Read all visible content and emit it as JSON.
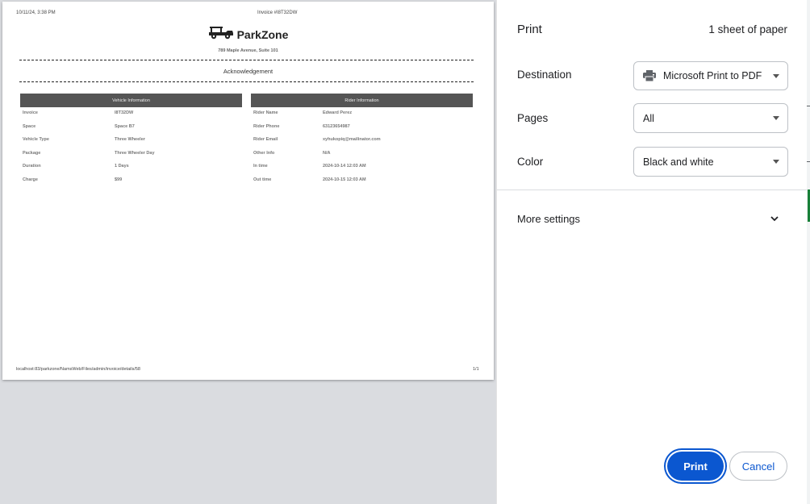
{
  "preview": {
    "header_date": "10/11/24, 3:38 PM",
    "header_title": "Invoice #I8T32DW",
    "brand_name": "ParkZone",
    "address": "789 Maple Avenue, Suite 101",
    "acknowledgement": "Acknowledgement",
    "vehicle_panel": {
      "title": "Vehicle Information",
      "rows": [
        {
          "label": "Invoice",
          "value": "I8T32DW"
        },
        {
          "label": "Space",
          "value": "Space B7"
        },
        {
          "label": "Vehicle Type",
          "value": "Three Wheeler"
        },
        {
          "label": "Package",
          "value": "Three Wheeler Day"
        },
        {
          "label": "Duration",
          "value": "1 Days"
        },
        {
          "label": "Charge",
          "value": "$99"
        }
      ]
    },
    "rider_panel": {
      "title": "Rider Information",
      "rows": [
        {
          "label": "Rider Name",
          "value": "Edward Perez"
        },
        {
          "label": "Rider Phone",
          "value": "63123654987"
        },
        {
          "label": "Rider Email",
          "value": "xyhukopiq@mailinator.com"
        },
        {
          "label": "Other Info",
          "value": "N/A"
        },
        {
          "label": "In time",
          "value": "2024-10-14 12:03 AM"
        },
        {
          "label": "Out time",
          "value": "2024-10-15 12:03 AM"
        }
      ]
    },
    "footer_url": "localhost:83/parkzone/NamsWeb/Files/admin/invoice/details/58",
    "footer_page": "1/1"
  },
  "settings": {
    "title": "Print",
    "sheet_count": "1 sheet of paper",
    "destination_label": "Destination",
    "destination_value": "Microsoft Print to PDF",
    "destination_icon": "printer-icon",
    "pages_label": "Pages",
    "pages_value": "All",
    "color_label": "Color",
    "color_value": "Black and white",
    "more_settings": "More settings",
    "print_button": "Print",
    "cancel_button": "Cancel"
  },
  "colors": {
    "accent": "#0b57d0",
    "table_header": "#555555",
    "preview_background": "#dadce0"
  }
}
